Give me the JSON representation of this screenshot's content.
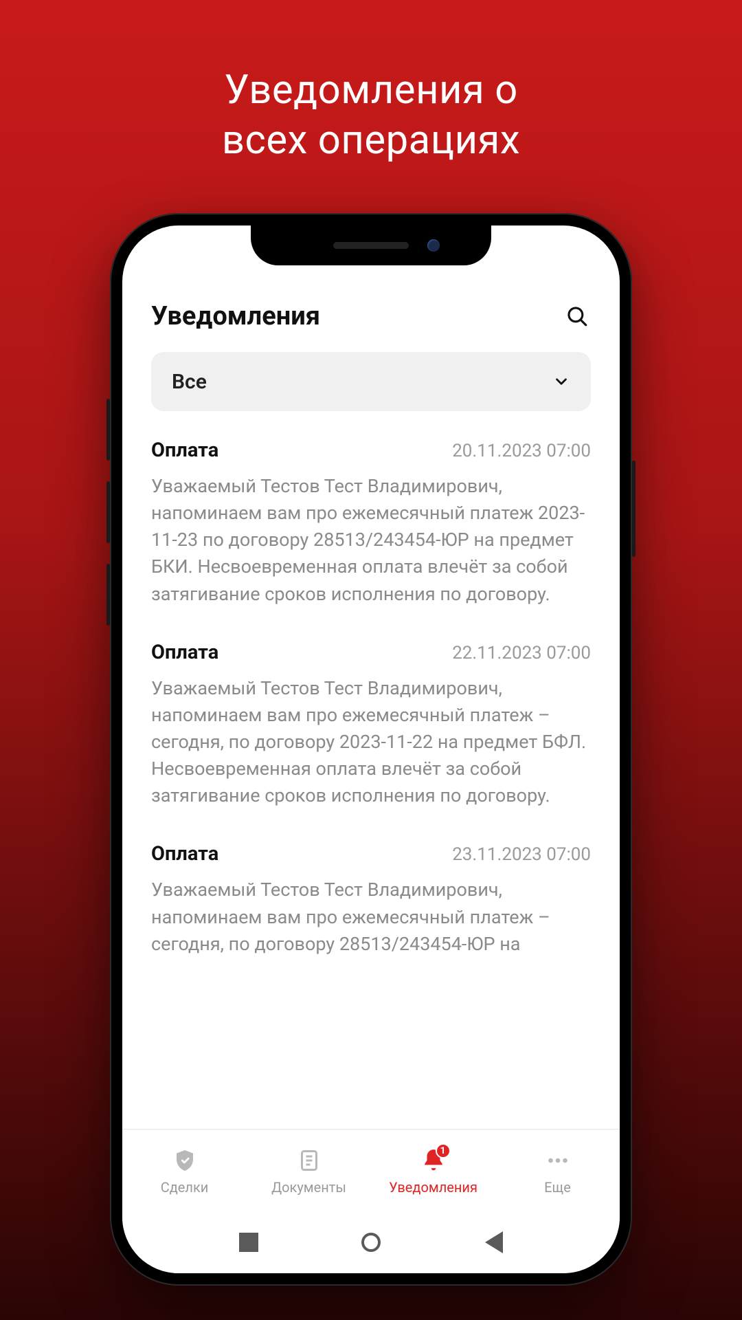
{
  "hero": {
    "line1": "Уведомления о",
    "line2": "всех операциях"
  },
  "header": {
    "title": "Уведомления"
  },
  "filter": {
    "label": "Все"
  },
  "notifications": [
    {
      "title": "Оплата",
      "date": "20.11.2023 07:00",
      "body": "Уважаемый Тестов Тест Владимирович, напоминаем вам про ежемесячный платеж 2023-11-23 по договору 28513/243454-ЮР на предмет БКИ. Несвоевременная оплата влечёт за собой затягивание сроков исполнения по договору."
    },
    {
      "title": "Оплата",
      "date": "22.11.2023 07:00",
      "body": "Уважаемый Тестов Тест Владимирович, напоминаем вам про ежемесячный платеж – сегодня, по договору 2023-11-22 на предмет БФЛ. Несвоевременная оплата влечёт за собой затягивание сроков исполнения по договору."
    },
    {
      "title": "Оплата",
      "date": "23.11.2023 07:00",
      "body": "Уважаемый Тестов Тест Владимирович, напоминаем вам про ежемесячный платеж – сегодня, по договору 28513/243454-ЮР на"
    }
  ],
  "tabs": {
    "deals": "Сделки",
    "documents": "Документы",
    "notifications": "Уведомления",
    "more": "Еще",
    "badge": "1"
  }
}
